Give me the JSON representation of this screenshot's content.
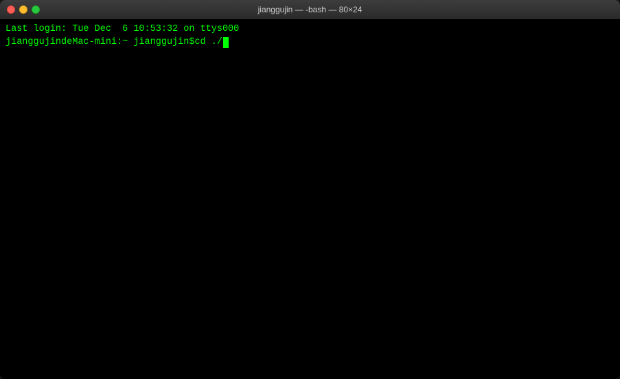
{
  "window": {
    "title": "jianggujin — -bash — 80×24",
    "traffic_lights": {
      "close_label": "close",
      "minimize_label": "minimize",
      "maximize_label": "maximize"
    }
  },
  "terminal": {
    "line1": "Last login: Tue Dec  6 10:53:32 on ttys000",
    "prompt": "jianggujindeMac-mini:~ jianggujin$ ",
    "command": "cd ./"
  },
  "colors": {
    "terminal_bg": "#000000",
    "terminal_text": "#00ff00",
    "titlebar_bg": "#2a2a2a",
    "title_text": "#cccccc"
  }
}
